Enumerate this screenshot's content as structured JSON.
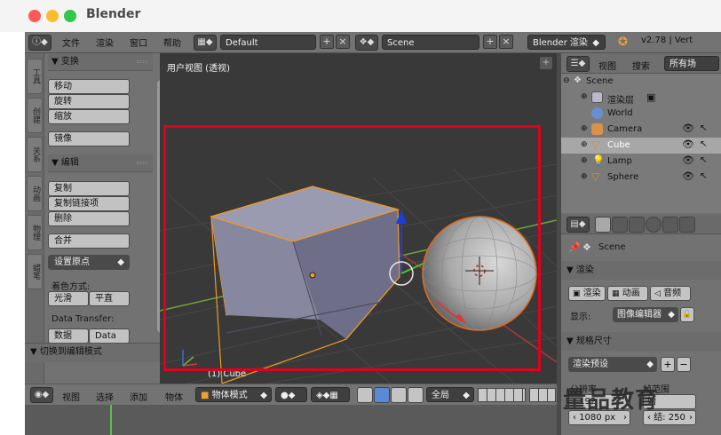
{
  "app": {
    "title": "Blender"
  },
  "top_menu": [
    "文件",
    "渲染",
    "窗口",
    "帮助"
  ],
  "layout_field": "Default",
  "scene_field": "Scene",
  "render_engine": "Blender 渲染",
  "version": "v2.78 | Vert",
  "toolshelf": {
    "tabs": [
      "工具",
      "创建",
      "关系",
      "动画",
      "物理",
      "蜡笔"
    ],
    "transform_header": "▼ 变换",
    "transform_buttons": [
      "移动",
      "旋转",
      "缩放"
    ],
    "mirror_button": "镜像",
    "edit_header": "▼ 编辑",
    "edit_buttons": [
      "复制",
      "复制链接项",
      "删除"
    ],
    "join_button": "合并",
    "origin_select": "设置原点",
    "shading_label": "着色方式:",
    "smooth_button": "光滑",
    "flat_button": "平直",
    "data_transfer_label": "Data Transfer:",
    "data_button": "数据",
    "data_layout_button": "Data La",
    "mode_toggle": "▼ 切换到编辑模式"
  },
  "viewport": {
    "title": "用户视图 (透视)",
    "object_label": "(1) Cube"
  },
  "outliner": {
    "header": {
      "view": "视图",
      "search": "搜索",
      "filter": "所有场"
    },
    "rows": [
      {
        "name": "Scene",
        "icon": "scene-icon"
      },
      {
        "name": "渲染层",
        "icon": "render-layers-icon"
      },
      {
        "name": "World",
        "icon": "world-icon"
      },
      {
        "name": "Camera",
        "icon": "camera-icon"
      },
      {
        "name": "Cube",
        "icon": "mesh-icon"
      },
      {
        "name": "Lamp",
        "icon": "lamp-icon"
      },
      {
        "name": "Sphere",
        "icon": "mesh-icon"
      }
    ]
  },
  "properties": {
    "breadcrumb": "Scene",
    "render_header": "▼ 渲染",
    "render_button": "渲染",
    "animation_button": "动画",
    "audio_button": "音频",
    "display_label": "显示:",
    "display_value": "图像编辑器",
    "dimensions_header": "▼ 规格尺寸",
    "render_preset": "渲染预设",
    "resolution_label": "分辨率",
    "frame_range_label": "帧范围",
    "res_x_partial": "192",
    "res_x": "1080 px",
    "start_label_partial": "始",
    "end_label": "结:",
    "end_value": "250"
  },
  "bottom_bar": {
    "menus": [
      "视图",
      "选择",
      "添加",
      "物体"
    ],
    "mode": "物体模式",
    "orientation": "全局"
  },
  "watermark": "量品教育",
  "colors": {
    "highlight_frame": "#e3001b",
    "object_outline": "#f19a21",
    "axis_x": "#d63b3b",
    "axis_y": "#5fb92f",
    "axis_z": "#1b3fd6"
  }
}
